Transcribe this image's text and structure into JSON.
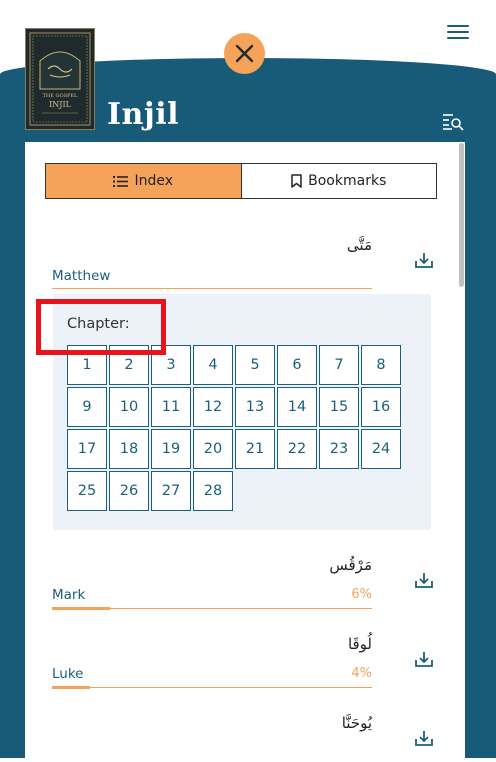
{
  "app": {
    "title": "Injil",
    "cover_line1": "THE GOSPEL",
    "cover_line2": "INJIL"
  },
  "icons": {
    "menu": "hamburger-menu-icon",
    "close": "close-icon",
    "search": "search-list-icon",
    "index": "list-icon",
    "bookmark": "bookmark-icon",
    "download": "download-icon"
  },
  "colors": {
    "primary": "#175b78",
    "accent": "#f5a25a",
    "highlight": "#e8141c",
    "chapter_bg": "#edf2f9"
  },
  "tabs": [
    {
      "label": "Index",
      "active": true
    },
    {
      "label": "Bookmarks",
      "active": false
    }
  ],
  "books": [
    {
      "name": "Matthew",
      "arabic": "مَتَّى",
      "progress": "",
      "progress_value": 0
    },
    {
      "name": "Mark",
      "arabic": "مَرْقُس",
      "progress": "6%",
      "progress_value": 0.06
    },
    {
      "name": "Luke",
      "arabic": "لُوقَا",
      "progress": "4%",
      "progress_value": 0.04
    },
    {
      "name": "",
      "arabic": "يُوحَنَّا",
      "progress": "",
      "progress_value": 0
    }
  ],
  "chapters": {
    "label": "Chapter:",
    "numbers": [
      "1",
      "2",
      "3",
      "4",
      "5",
      "6",
      "7",
      "8",
      "9",
      "10",
      "11",
      "12",
      "13",
      "14",
      "15",
      "16",
      "17",
      "18",
      "19",
      "20",
      "21",
      "22",
      "23",
      "24",
      "25",
      "26",
      "27",
      "28"
    ]
  }
}
